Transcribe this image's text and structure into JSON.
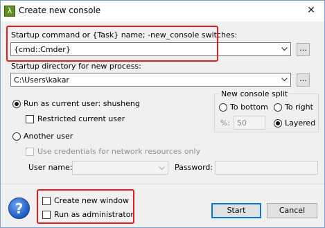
{
  "window": {
    "title": "Create new console",
    "app_icon_glyph": "λ",
    "close_glyph": "✕"
  },
  "startup_command": {
    "label": "Startup command or {Task} name; -new_console switches:",
    "value": "{cmd::Cmder}",
    "browse_label": "..."
  },
  "startup_directory": {
    "label": "Startup directory for new process:",
    "value": "C:\\Users\\kakar",
    "browse_label": "..."
  },
  "run_as": {
    "current_user_label": "Run as current user: shusheng",
    "current_user_selected": true,
    "restricted_label": "Restricted current user",
    "restricted_checked": false,
    "another_user_label": "Another user",
    "another_user_selected": false,
    "use_credentials_label": "Use credentials for network resources only",
    "user_name_label": "User name:",
    "user_name_value": "",
    "password_label": "Password:",
    "password_value": ""
  },
  "split": {
    "group_label": "New console split",
    "to_bottom_label": "To bottom",
    "to_right_label": "To right",
    "percent_label": "%:",
    "percent_value": "50",
    "layered_label": "Layered",
    "selected": "Layered"
  },
  "options": {
    "new_window_label": "Create new window",
    "new_window_checked": false,
    "admin_label": "Run as administrator",
    "admin_checked": false
  },
  "buttons": {
    "start_label": "Start",
    "cancel_label": "Cancel",
    "help_glyph": "?"
  },
  "colors": {
    "highlight_box": "#e01f1f",
    "default_button_border": "#0078d7",
    "help_icon": "#1f5fc6"
  }
}
